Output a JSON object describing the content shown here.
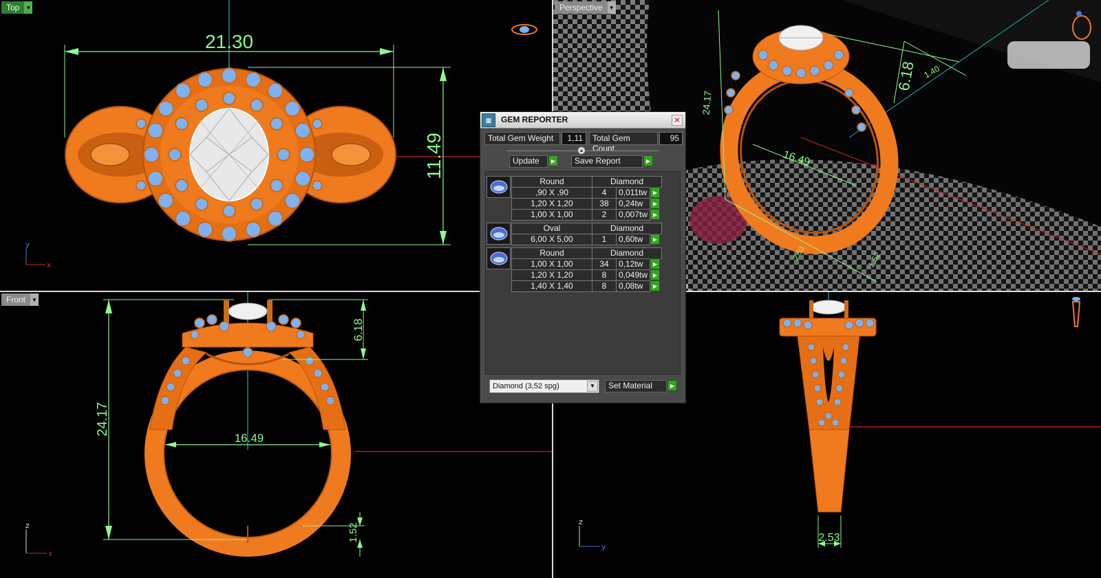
{
  "viewports": {
    "top": {
      "label": "Top"
    },
    "perspective": {
      "label": "Perspective"
    },
    "front": {
      "label": "Front"
    },
    "right": {
      "label": ""
    }
  },
  "dimensions": {
    "top_width": "21.30",
    "top_height": "11.49",
    "front_height": "24.17",
    "front_setting_height": "6.18",
    "front_inner_diameter": "16.49",
    "front_shank_thickness": "1.52",
    "right_shank_width": "2.53",
    "persp_setting_height": "6.18",
    "persp_inner_diameter": "16.49",
    "persp_small_a": "1.40",
    "persp_height": "24.17",
    "persp_width_a": "2.53",
    "persp_thickness_a": "1.52"
  },
  "axes": {
    "top": {
      "v": "y",
      "h": "x"
    },
    "front": {
      "v": "z",
      "h": "x"
    },
    "right": {
      "v": "z",
      "h": "y"
    }
  },
  "gem_reporter": {
    "title": "GEM REPORTER",
    "total_weight_label": "Total Gem Weight",
    "total_weight_value": "1,11",
    "total_count_label": "Total Gem Count",
    "total_count_value": "95",
    "update_label": "Update",
    "save_report_label": "Save Report",
    "groups": [
      {
        "shape": "Round",
        "material": "Diamond",
        "rows": [
          {
            "size": ",90 X ,90",
            "count": "4",
            "weight": "0,011tw"
          },
          {
            "size": "1,20 X 1,20",
            "count": "38",
            "weight": "0,24tw"
          },
          {
            "size": "1,00 X 1,00",
            "count": "2",
            "weight": "0,007tw"
          }
        ]
      },
      {
        "shape": "Oval",
        "material": "Diamond",
        "rows": [
          {
            "size": "6,00 X 5,00",
            "count": "1",
            "weight": "0,60tw"
          }
        ]
      },
      {
        "shape": "Round",
        "material": "Diamond",
        "rows": [
          {
            "size": "1,00 X 1,00",
            "count": "34",
            "weight": "0,12tw"
          },
          {
            "size": "1,20 X 1,20",
            "count": "8",
            "weight": "0,049tw"
          },
          {
            "size": "1,40 X 1,40",
            "count": "8",
            "weight": "0,08tw"
          }
        ]
      }
    ],
    "material_select": "Diamond    (3,52 spg)",
    "set_material_label": "Set Material"
  },
  "colors": {
    "metal": "#f07a1e",
    "metal_dark": "#b8520c",
    "stone_blue": "#7fb0f0",
    "dimension_green": "#8dfa8d",
    "axis_red": "#d02020",
    "axis_cyan": "#20b0b0"
  }
}
